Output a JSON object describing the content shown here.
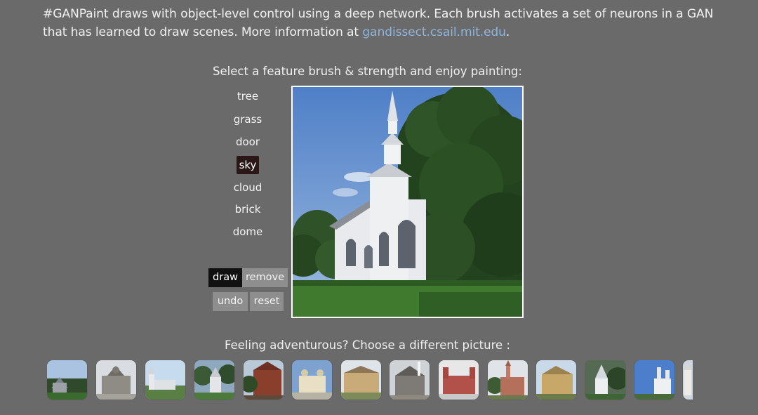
{
  "intro": {
    "text": "#GANPaint draws with object-level control using a deep network. Each brush activates a set of neurons in a GAN that has learned to draw scenes. More information at ",
    "link_text": "gandissect.csail.mit.edu",
    "suffix": "."
  },
  "prompt_select": "Select a feature brush & strength and enjoy painting:",
  "brushes": [
    "tree",
    "grass",
    "door",
    "sky",
    "cloud",
    "brick",
    "dome"
  ],
  "selected_brush": "sky",
  "mode_buttons": {
    "draw": "draw",
    "remove": "remove",
    "undo": "undo",
    "reset": "reset"
  },
  "active_mode": "draw",
  "canvas": {
    "subject": "white church with steeple beside trees"
  },
  "prompt_choose": "Feeling adventurous? Choose a different picture :",
  "thumbnails": [
    "church with dark trees",
    "gray stone church",
    "white church on hill",
    "small chapel with trees",
    "red brick church",
    "white church with dome towers",
    "long tan church building",
    "gray stone gabled church",
    "red cathedral with towers",
    "red brick church with spire",
    "yellow brick church",
    "white steeple church with trees",
    "white church with twin towers",
    "white tower church"
  ],
  "colors": {
    "background": "#6a6a6a",
    "link": "#8fb4dd",
    "selected_brush": "#2b1717",
    "active_button": "#111111",
    "inactive_button": "#8e8e8e"
  }
}
